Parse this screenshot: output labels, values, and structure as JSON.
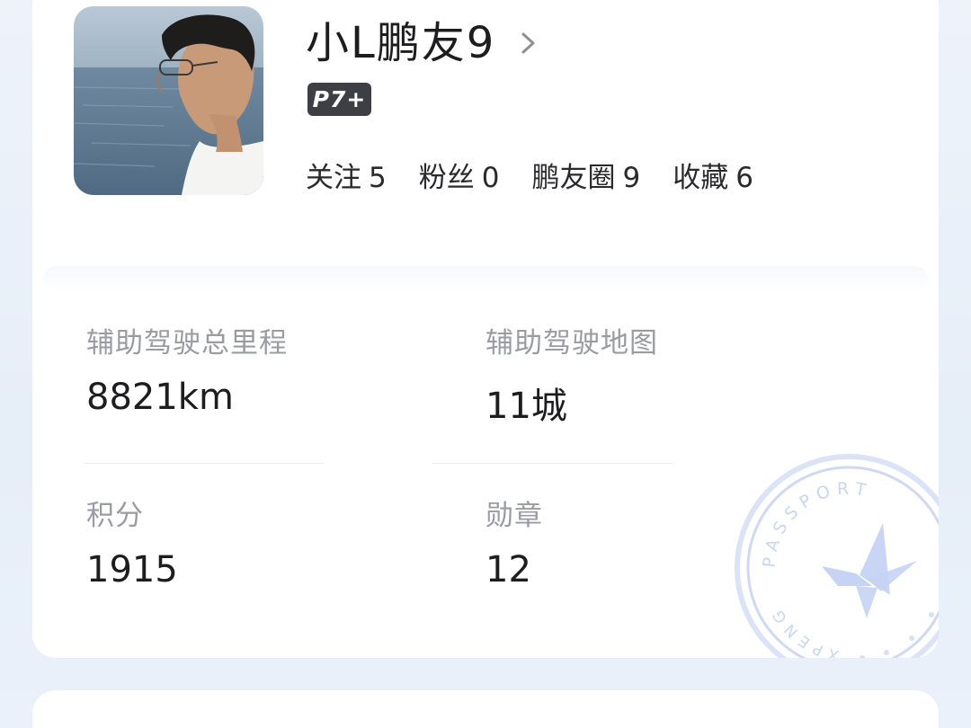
{
  "profile": {
    "username": "小L鹏友9",
    "car_badge": "P7+",
    "stats": [
      {
        "label": "关注",
        "value": "5"
      },
      {
        "label": "粉丝",
        "value": "0"
      },
      {
        "label": "鹏友圈",
        "value": "9"
      },
      {
        "label": "收藏",
        "value": "6"
      }
    ]
  },
  "metrics": [
    {
      "label": "辅助驾驶总里程",
      "value": "8821km"
    },
    {
      "label": "辅助驾驶地图",
      "value": "11城"
    },
    {
      "label": "积分",
      "value": "1915"
    },
    {
      "label": "勋章",
      "value": "12"
    }
  ],
  "stamp": {
    "text_top": "PASSPORT",
    "text_side": "XPENG",
    "icon": "xpeng-logo-icon",
    "color": "#c9d6f4"
  },
  "colors": {
    "page_bg": "#e8f0f9",
    "badge_bg": "#3d3f44",
    "label_gray": "#9a9ca2"
  }
}
